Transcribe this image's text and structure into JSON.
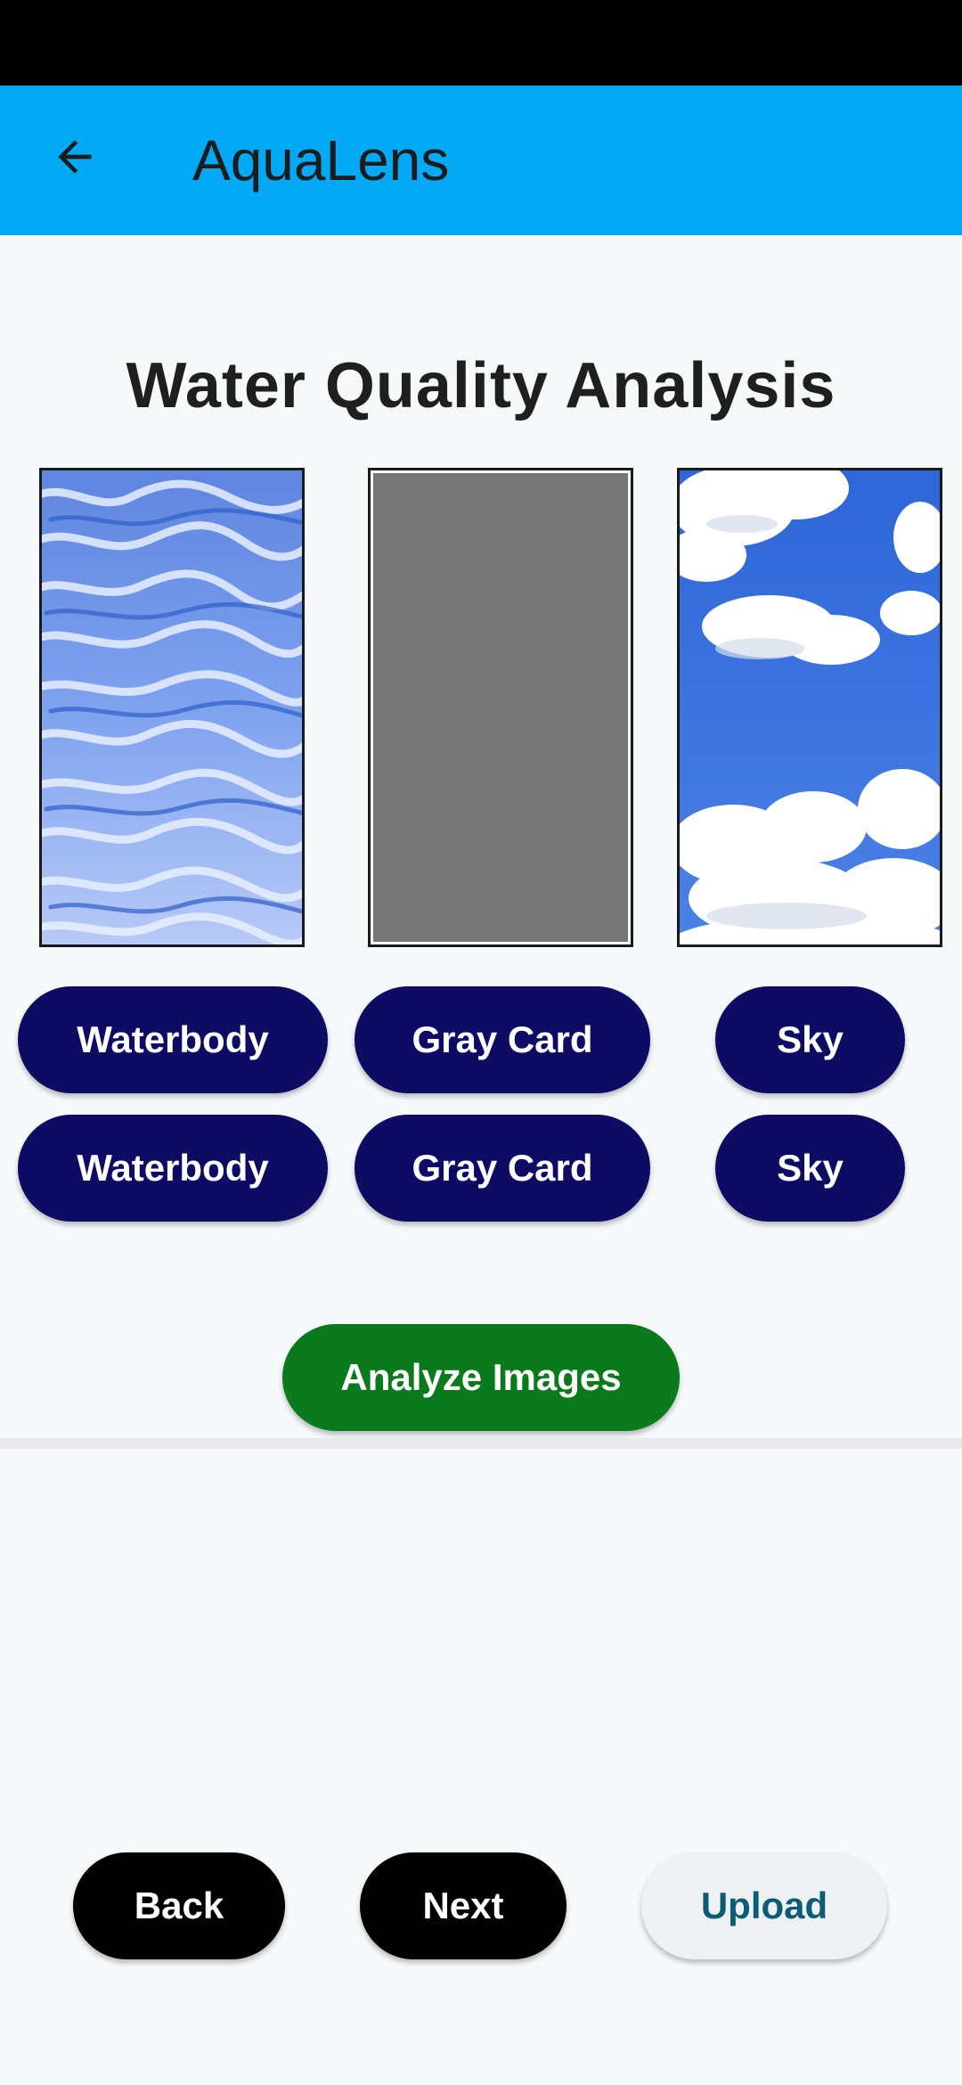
{
  "app_bar": {
    "title": "AquaLens",
    "back_icon": "arrow-left-icon",
    "color": "#03a9f4"
  },
  "main": {
    "title": "Water Quality Analysis",
    "previews": [
      {
        "name": "waterbody-preview",
        "icon": "water-image"
      },
      {
        "name": "gray-card-preview",
        "icon": "gray-image",
        "color": "#777777"
      },
      {
        "name": "sky-preview",
        "icon": "sky-image"
      }
    ],
    "capture_buttons": [
      {
        "label": "Waterbody"
      },
      {
        "label": "Gray Card"
      },
      {
        "label": "Sky"
      }
    ],
    "upload_buttons": [
      {
        "label": "Waterbody"
      },
      {
        "label": "Gray Card"
      },
      {
        "label": "Sky"
      }
    ],
    "analyze_label": "Analyze Images",
    "button_color": "#0d0b63",
    "analyze_color": "#0b7a1c"
  },
  "footer": {
    "back_label": "Back",
    "next_label": "Next",
    "upload_label": "Upload"
  }
}
